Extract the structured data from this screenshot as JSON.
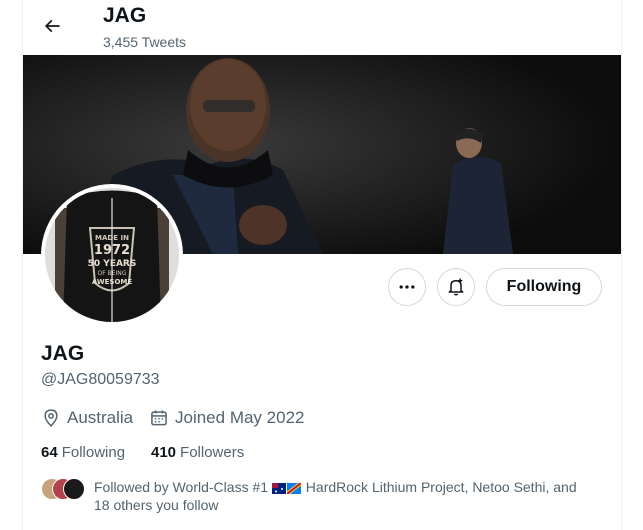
{
  "header": {
    "display_name": "JAG",
    "tweet_count": "3,455 Tweets"
  },
  "banner": {
    "text_lines": [
      "MADE IN",
      "1972",
      "50 YEARS",
      "OF BEING",
      "AWESOME"
    ]
  },
  "actions": {
    "following_label": "Following"
  },
  "profile": {
    "display_name": "JAG",
    "handle": "@JAG80059733",
    "location": "Australia",
    "joined": "Joined May 2022",
    "following_count": "64",
    "following_label": "Following",
    "followers_count": "410",
    "followers_label": "Followers"
  },
  "followed_by": {
    "prefix": "Followed by World-Class #1 ",
    "rest": " HardRock Lithium Project, Netoo Sethi, and",
    "line2": "18 others you follow"
  },
  "colors": {
    "text": "#0f1419",
    "secondary": "#536471",
    "border": "#cfd9de"
  },
  "icons": [
    "back-arrow-icon",
    "more-icon",
    "notification-bell-icon",
    "location-pin-icon",
    "calendar-icon"
  ]
}
